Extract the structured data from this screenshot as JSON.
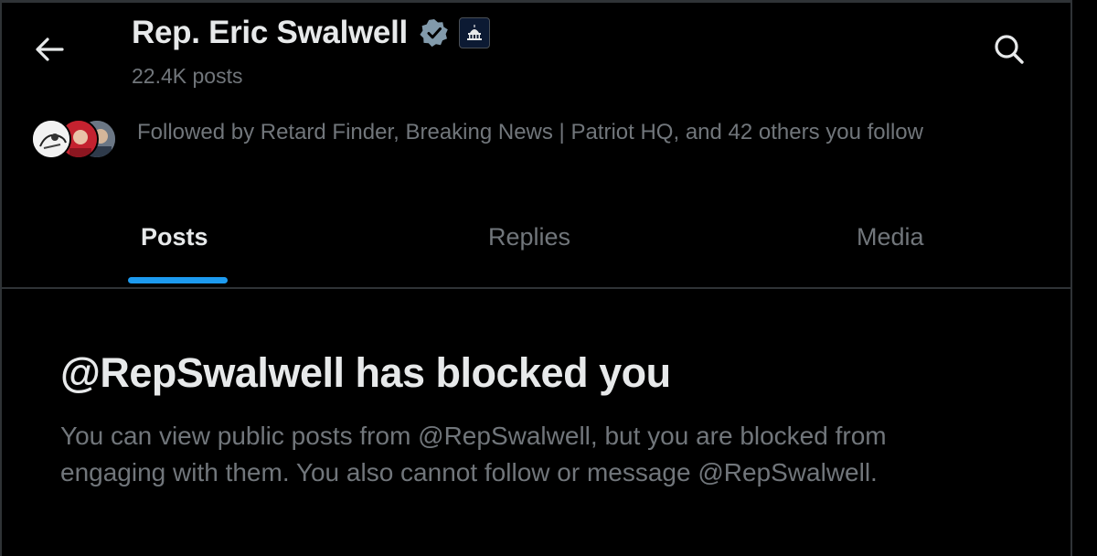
{
  "header": {
    "display_name": "Rep. Eric Swalwell",
    "post_count": "22.4K posts",
    "back_icon": "arrow-left-icon",
    "search_icon": "search-icon",
    "verified_icon": "verified-badge-icon",
    "affiliation_icon": "capitol-building-icon"
  },
  "followers": {
    "text": "Followed by Retard Finder, Breaking News | Patriot HQ, and 42 others you follow"
  },
  "tabs": [
    {
      "label": "Posts",
      "selected": true
    },
    {
      "label": "Replies",
      "selected": false
    },
    {
      "label": "Media",
      "selected": false
    }
  ],
  "blocked": {
    "title": "@RepSwalwell has blocked you",
    "message": "You can view public posts from @RepSwalwell, but you are blocked from engaging with them. You also cannot follow or message @RepSwalwell."
  },
  "colors": {
    "background": "#000000",
    "primary_text": "#e7e9ea",
    "secondary_text": "#71767b",
    "accent": "#1d9bf0",
    "border": "#2f3336"
  }
}
